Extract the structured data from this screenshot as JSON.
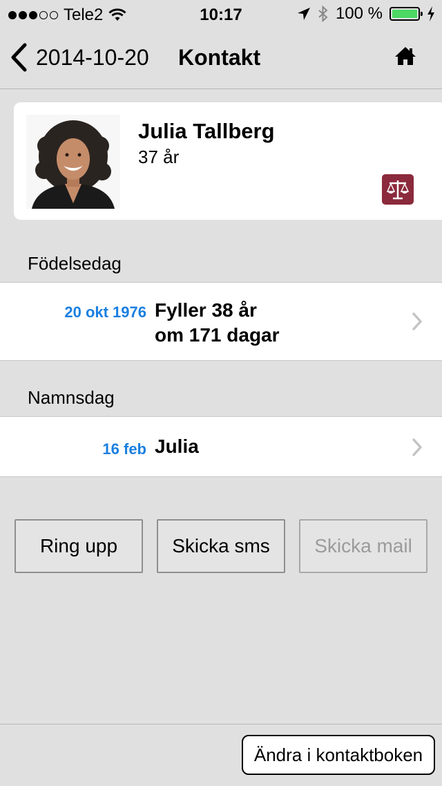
{
  "status_bar": {
    "carrier": "Tele2",
    "time": "10:17",
    "battery_text": "100 %",
    "battery_level": 1.0,
    "signal_bars_filled": 3,
    "signal_bars_total": 5
  },
  "nav": {
    "back_label": "2014-10-20",
    "title": "Kontakt",
    "home_icon": "home-icon"
  },
  "contact": {
    "name": "Julia Tallberg",
    "age": "37 år",
    "badge_icon": "scales-icon",
    "badge_color": "#8b2a3c"
  },
  "birthday": {
    "header": "Födelsedag",
    "date": "20 okt 1976",
    "line1": "Fyller 38 år",
    "line2": "om 171 dagar"
  },
  "nameday": {
    "header": "Namnsdag",
    "date": "16 feb",
    "name": "Julia"
  },
  "actions": {
    "call": "Ring upp",
    "sms": "Skicka sms",
    "mail": "Skicka mail"
  },
  "bottom": {
    "edit_label": "Ändra i kontaktboken"
  },
  "colors": {
    "accent": "#1a7fe0",
    "battery": "#4cd964",
    "background": "#e0e0e0"
  }
}
